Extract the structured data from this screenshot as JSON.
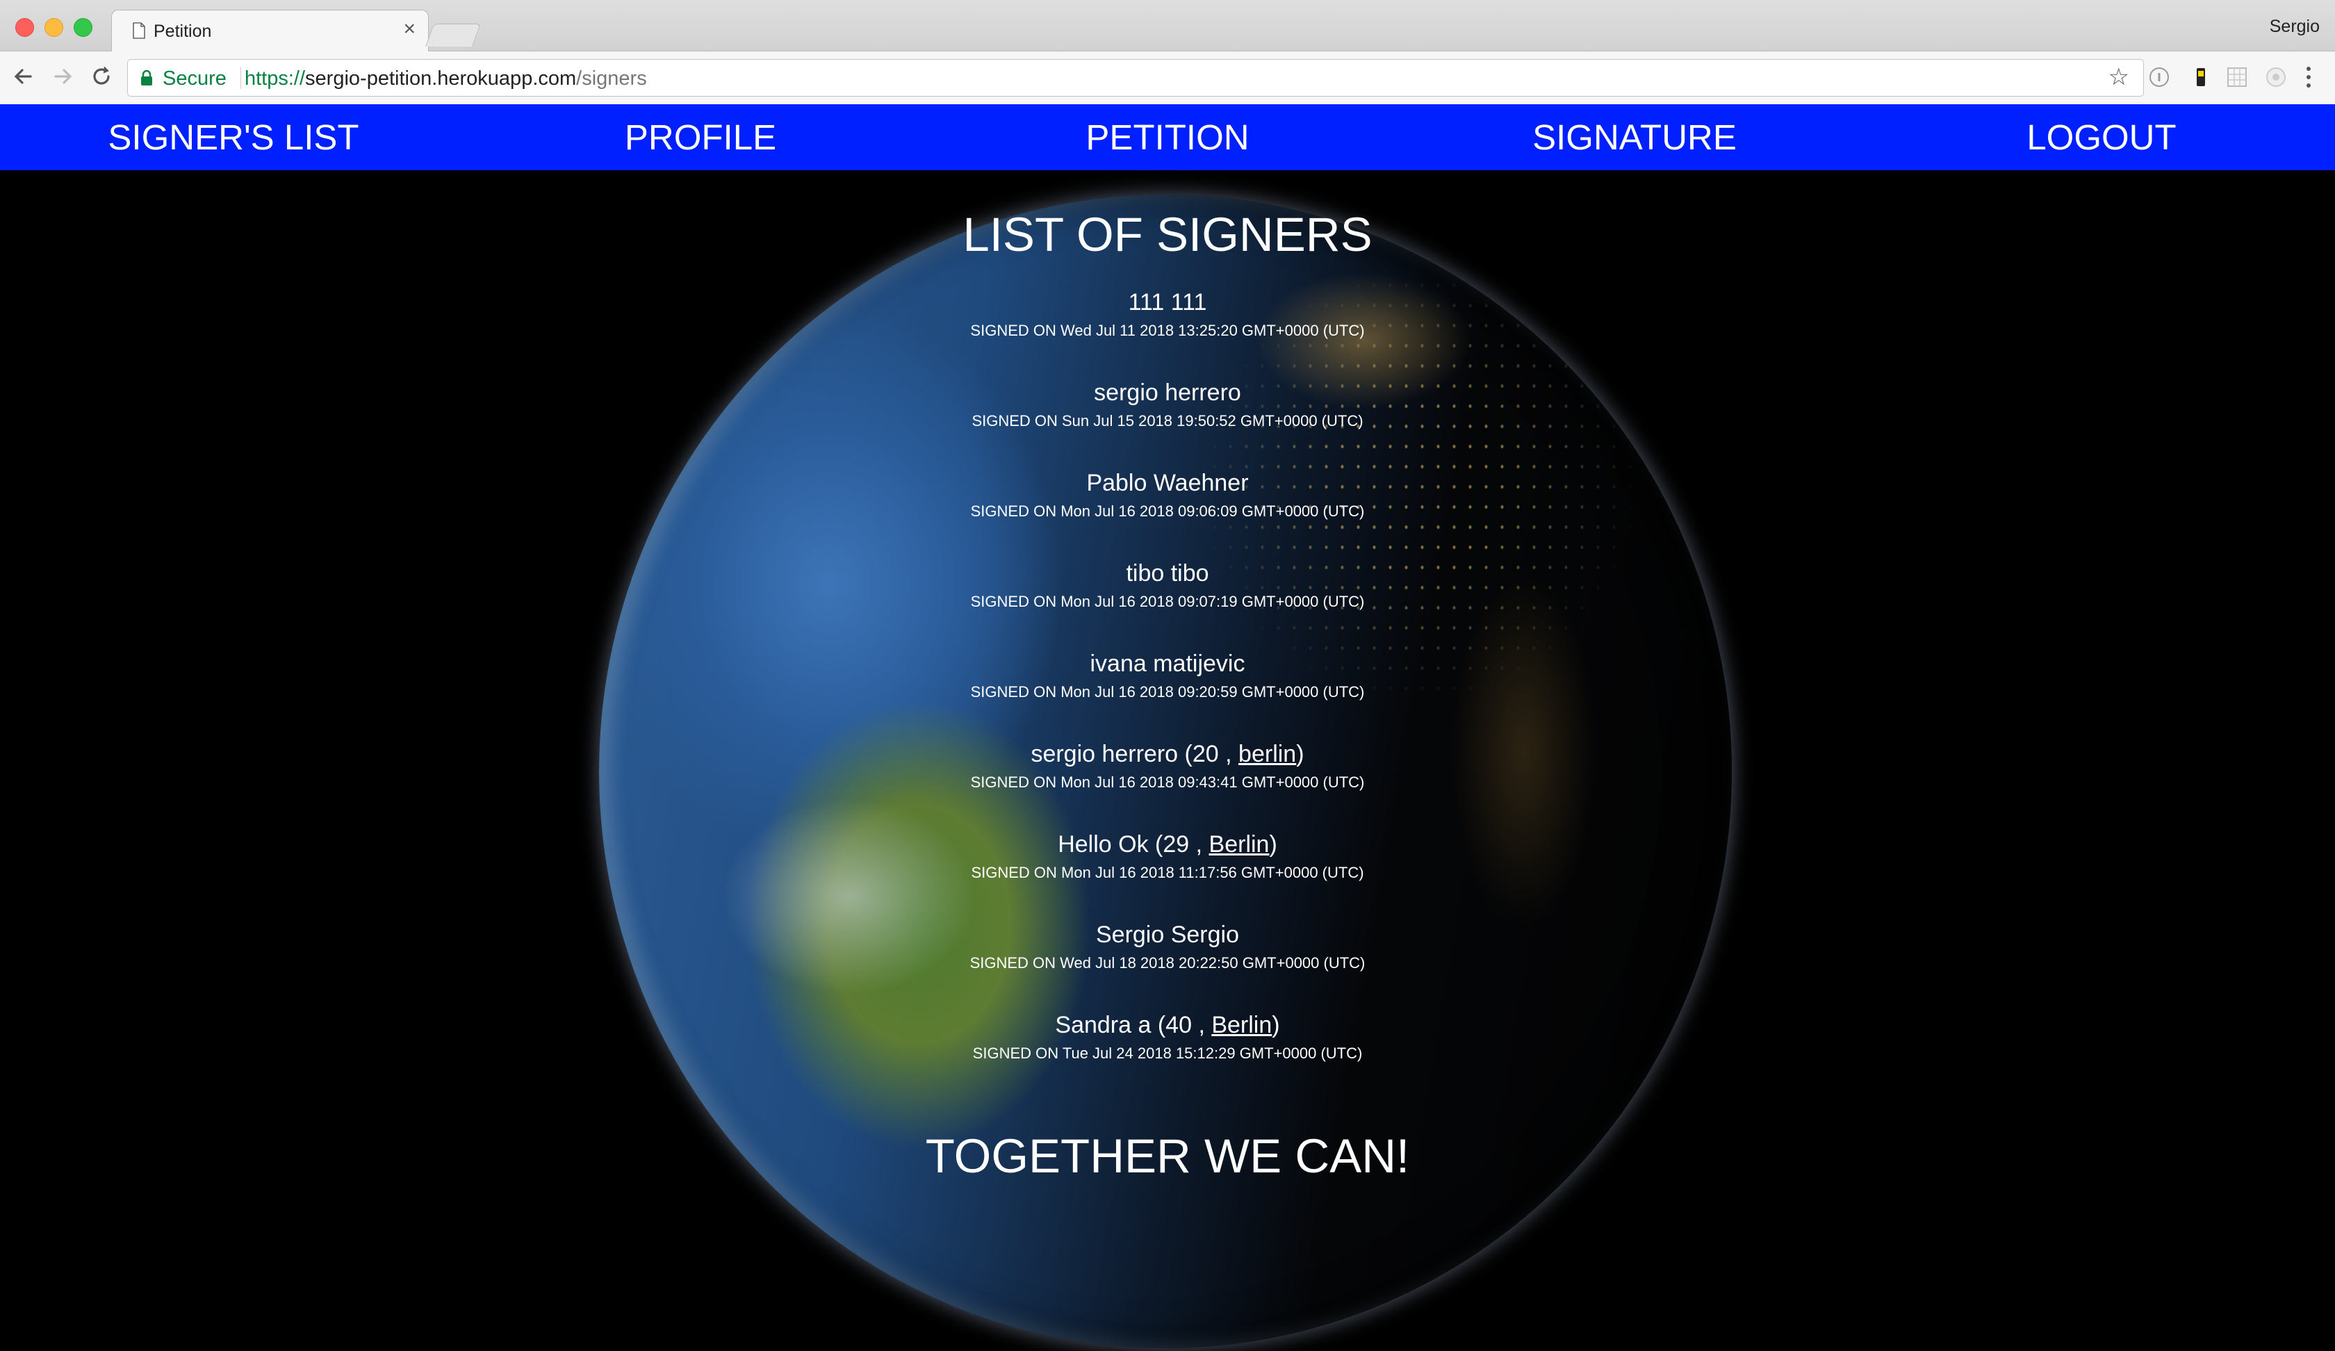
{
  "browser": {
    "tab_title": "Petition",
    "tab_close_glyph": "×",
    "profile_name": "Sergio",
    "secure_label": "Secure",
    "url": {
      "scheme": "https://",
      "host": "sergio-petition.herokuapp.com",
      "path": "/signers"
    },
    "bookmark_glyph": "☆",
    "icons": [
      "back-icon",
      "forward-icon",
      "reload-icon",
      "lock-icon",
      "star-icon",
      "extension-icons",
      "menu-icon"
    ]
  },
  "nav": {
    "signers": "SIGNER'S LIST",
    "profile": "PROFILE",
    "petition": "PETITION",
    "signature": "SIGNATURE",
    "logout": "LOGOUT"
  },
  "heading": "LIST OF SIGNERS",
  "signers": [
    {
      "name": "111 111",
      "date": "SIGNED ON Wed Jul 11 2018 13:25:20 GMT+0000 (UTC)"
    },
    {
      "name": "sergio herrero",
      "date": "SIGNED ON Sun Jul 15 2018 19:50:52 GMT+0000 (UTC)"
    },
    {
      "name": "Pablo Waehner",
      "date": "SIGNED ON Mon Jul 16 2018 09:06:09 GMT+0000 (UTC)"
    },
    {
      "name": "tibo tibo",
      "date": "SIGNED ON Mon Jul 16 2018 09:07:19 GMT+0000 (UTC)"
    },
    {
      "name": "ivana matijevic",
      "date": "SIGNED ON Mon Jul 16 2018 09:20:59 GMT+0000 (UTC)"
    },
    {
      "name": "sergio herrero",
      "age": "20",
      "city": "berlin",
      "date": "SIGNED ON Mon Jul 16 2018 09:43:41 GMT+0000 (UTC)"
    },
    {
      "name": "Hello Ok",
      "age": "29",
      "city": "Berlin",
      "date": "SIGNED ON Mon Jul 16 2018 11:17:56 GMT+0000 (UTC)"
    },
    {
      "name": "Sergio Sergio",
      "date": "SIGNED ON Wed Jul 18 2018 20:22:50 GMT+0000 (UTC)"
    },
    {
      "name": "Sandra a",
      "age": "40",
      "city": "Berlin",
      "date": "SIGNED ON Tue Jul 24 2018 15:12:29 GMT+0000 (UTC)"
    }
  ],
  "motto": "TOGETHER WE CAN!",
  "colors": {
    "nav_background": "#0020ff",
    "page_background": "#000000",
    "text": "#ffffff",
    "secure_green": "#0b8043"
  }
}
